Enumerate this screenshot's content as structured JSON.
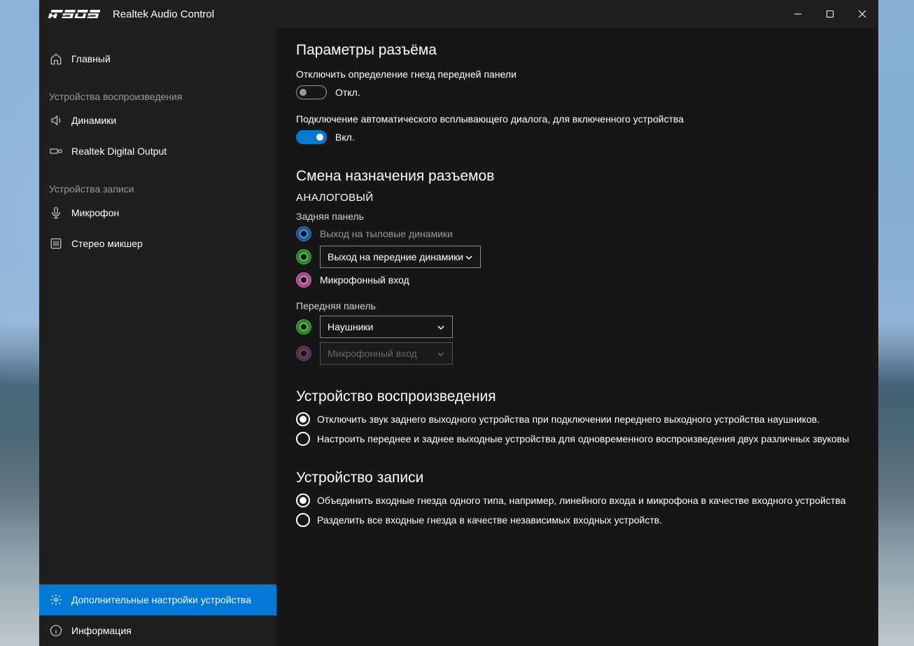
{
  "app": {
    "title": "Realtek Audio Control"
  },
  "sidebar": {
    "home": "Главный",
    "section_playback": "Устройства воспроизведения",
    "speakers": "Динамики",
    "digital_out": "Realtek Digital Output",
    "section_record": "Устройства записи",
    "microphone": "Микрофон",
    "stereo_mix": "Стерео микшер",
    "advanced": "Дополнительные настройки устройства",
    "info": "Информация"
  },
  "main": {
    "connector_heading": "Параметры разъёма",
    "disable_front_detect": "Отключить определение гнезд передней панели",
    "toggle_off": "Откл.",
    "auto_popup": "Подключение автоматического всплывающего диалога, для включенного устройства",
    "toggle_on": "Вкл.",
    "retasking_heading": "Смена назначения разъемов",
    "analog": "АНАЛОГОВЫЙ",
    "back_panel": "Задняя панель",
    "jack_rear_out": "Выход на тыловые динамики",
    "jack_front_out": "Выход на передние динамики",
    "jack_mic_in": "Микрофонный вход",
    "front_panel": "Передняя панель",
    "jack_headphones": "Наушники",
    "jack_mic_in2": "Микрофонный вход",
    "playback_heading": "Устройство воспроизведения",
    "playback_opt1": "Отключить звук заднего выходного устройства при подключении переднего выходного устройства наушников.",
    "playback_opt2": "Настроить переднее и заднее выходные устройства для одновременного воспроизведения двух различных звуковы",
    "record_heading": "Устройство записи",
    "record_opt1": "Объединить входные гнезда одного типа, например, линейного входа и микрофона в качестве входного устройства",
    "record_opt2": "Разделить все входные гнезда в качестве независимых входных устройств."
  }
}
